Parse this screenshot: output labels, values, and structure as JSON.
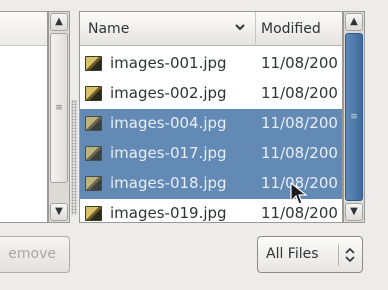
{
  "file_list": {
    "columns": {
      "name": "Name",
      "modified": "Modified"
    },
    "rows": [
      {
        "name": "images-001.jpg",
        "modified": "11/08/200",
        "selected": false
      },
      {
        "name": "images-002.jpg",
        "modified": "11/08/200",
        "selected": false
      },
      {
        "name": "images-004.jpg",
        "modified": "11/08/200",
        "selected": true
      },
      {
        "name": "images-017.jpg",
        "modified": "11/08/200",
        "selected": true
      },
      {
        "name": "images-018.jpg",
        "modified": "11/08/200",
        "selected": true
      },
      {
        "name": "images-019.jpg",
        "modified": "11/08/200",
        "selected": false
      }
    ]
  },
  "buttons": {
    "remove": "emove"
  },
  "filter": {
    "selected": "All Files"
  },
  "icons": {
    "column_sort": "chevron-down-icon",
    "file": "image-file-icon",
    "scroll_up": "arrow-up-icon",
    "scroll_down": "arrow-down-icon",
    "filter_toggle": "up-down-arrows-icon",
    "cursor": "mouse-pointer-icon"
  },
  "colors": {
    "selection": "#6389b5",
    "scroll_thumb": "#4a76a8"
  }
}
